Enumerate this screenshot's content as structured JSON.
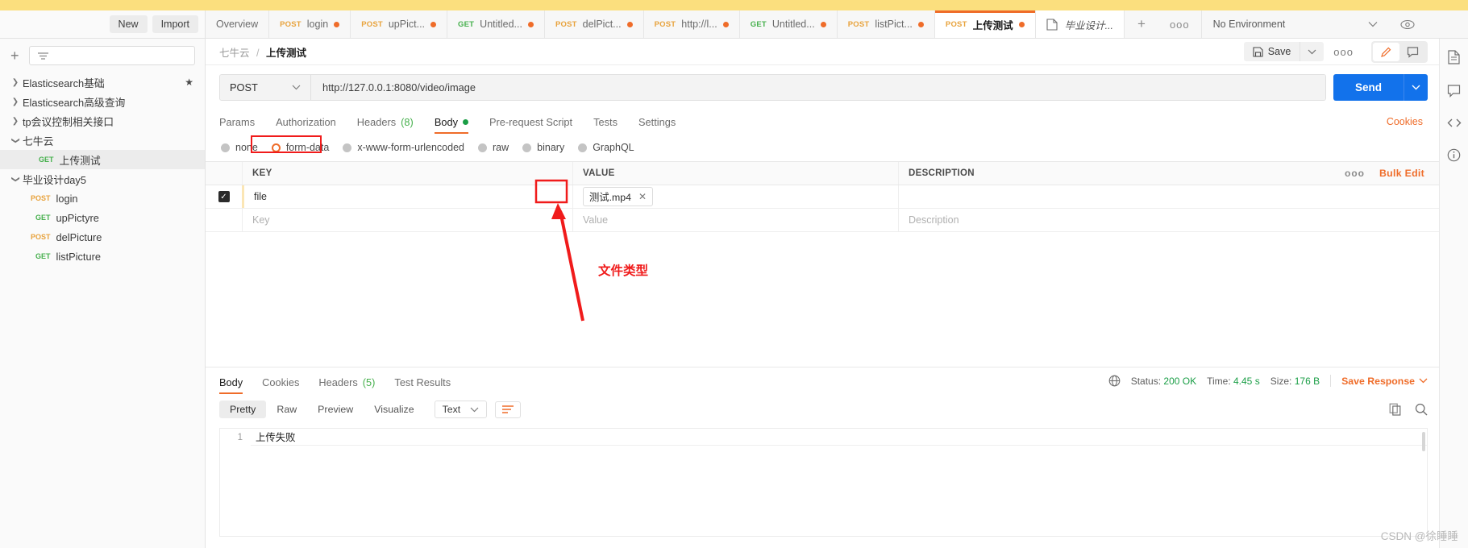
{
  "header": {
    "new_label": "New",
    "import_label": "Import",
    "tabs": [
      {
        "method": "",
        "label": "Overview",
        "dirty": false,
        "active": false,
        "type": "overview"
      },
      {
        "method": "POST",
        "label": "login",
        "dirty": true,
        "active": false,
        "type": "request"
      },
      {
        "method": "POST",
        "label": "upPict...",
        "dirty": true,
        "active": false,
        "type": "request"
      },
      {
        "method": "GET",
        "label": "Untitled...",
        "dirty": true,
        "active": false,
        "type": "request"
      },
      {
        "method": "POST",
        "label": "delPict...",
        "dirty": true,
        "active": false,
        "type": "request"
      },
      {
        "method": "POST",
        "label": "http://l...",
        "dirty": true,
        "active": false,
        "type": "request"
      },
      {
        "method": "GET",
        "label": "Untitled...",
        "dirty": true,
        "active": false,
        "type": "request"
      },
      {
        "method": "POST",
        "label": "listPict...",
        "dirty": true,
        "active": false,
        "type": "request"
      },
      {
        "method": "POST",
        "label": "上传测试",
        "dirty": true,
        "active": true,
        "type": "request"
      },
      {
        "method": "",
        "label": "毕业设计...",
        "dirty": false,
        "active": false,
        "type": "document"
      }
    ],
    "add_tab_icon": "plus-icon",
    "more_tabs_icon": "ellipsis-icon",
    "environment": "No Environment",
    "eye_icon": "eye-icon"
  },
  "sidebar": {
    "add_icon": "plus-icon",
    "filter_icon": "filter-icon",
    "filter_placeholder": "",
    "items": [
      {
        "label": "Elasticsearch基础",
        "expanded": false,
        "starred": true,
        "depth": 0,
        "method": ""
      },
      {
        "label": "Elasticsearch高级查询",
        "expanded": false,
        "starred": false,
        "depth": 0,
        "method": ""
      },
      {
        "label": "tp会议控制相关接口",
        "expanded": false,
        "starred": false,
        "depth": 0,
        "method": ""
      },
      {
        "label": "七牛云",
        "expanded": true,
        "starred": false,
        "depth": 0,
        "method": ""
      },
      {
        "label": "上传测试",
        "expanded": null,
        "starred": false,
        "depth": 1,
        "method": "GET",
        "selected": true
      },
      {
        "label": "毕业设计day5",
        "expanded": true,
        "starred": false,
        "depth": 0,
        "method": ""
      },
      {
        "label": "login",
        "expanded": null,
        "starred": false,
        "depth": 1,
        "method": "POST"
      },
      {
        "label": "upPictyre",
        "expanded": null,
        "starred": false,
        "depth": 1,
        "method": "GET"
      },
      {
        "label": "delPicture",
        "expanded": null,
        "starred": false,
        "depth": 1,
        "method": "POST"
      },
      {
        "label": "listPicture",
        "expanded": null,
        "starred": false,
        "depth": 1,
        "method": "GET"
      }
    ]
  },
  "request": {
    "breadcrumb_collection": "七牛云",
    "breadcrumb_separator": "/",
    "breadcrumb_name": "上传测试",
    "save_label": "Save",
    "save_caret_icon": "chevron-down-icon",
    "more_icon": "ellipsis-icon",
    "edit_icon": "pencil-icon",
    "comment_icon": "comment-icon",
    "method": "POST",
    "method_caret_icon": "chevron-down-icon",
    "url": "http://127.0.0.1:8080/video/image",
    "send_label": "Send",
    "send_caret_icon": "chevron-down-icon",
    "tabs": [
      {
        "label": "Params",
        "active": false,
        "count": null,
        "dot": false
      },
      {
        "label": "Authorization",
        "active": false,
        "count": null,
        "dot": false
      },
      {
        "label": "Headers",
        "active": false,
        "count": "(8)",
        "dot": false
      },
      {
        "label": "Body",
        "active": true,
        "count": null,
        "dot": true
      },
      {
        "label": "Pre-request Script",
        "active": false,
        "count": null,
        "dot": false
      },
      {
        "label": "Tests",
        "active": false,
        "count": null,
        "dot": false
      },
      {
        "label": "Settings",
        "active": false,
        "count": null,
        "dot": false
      }
    ],
    "cookies_link": "Cookies",
    "body_types": [
      {
        "label": "none",
        "selected": false
      },
      {
        "label": "form-data",
        "selected": true,
        "highlighted": true
      },
      {
        "label": "x-www-form-urlencoded",
        "selected": false
      },
      {
        "label": "raw",
        "selected": false
      },
      {
        "label": "binary",
        "selected": false
      },
      {
        "label": "GraphQL",
        "selected": false
      }
    ],
    "table": {
      "columns": [
        "KEY",
        "VALUE",
        "DESCRIPTION"
      ],
      "more_icon": "ellipsis-icon",
      "bulk_edit_label": "Bulk Edit",
      "rows": [
        {
          "checked": true,
          "key": "file",
          "value_chip": "测试.mp4",
          "chip_remove_icon": "close-icon",
          "description": ""
        },
        {
          "checked": false,
          "key": "",
          "value_chip": "",
          "description": "",
          "key_placeholder": "Key",
          "value_placeholder": "Value",
          "description_placeholder": "Description"
        }
      ]
    }
  },
  "annotations": {
    "arrow_note": "文件类型",
    "box_color": "#f01b1b"
  },
  "response": {
    "tabs": [
      {
        "label": "Body",
        "active": true,
        "count": null
      },
      {
        "label": "Cookies",
        "active": false,
        "count": null
      },
      {
        "label": "Headers",
        "active": false,
        "count": "(5)"
      },
      {
        "label": "Test Results",
        "active": false,
        "count": null
      }
    ],
    "globe_icon": "globe-icon",
    "status_label": "Status:",
    "status_value": "200 OK",
    "time_label": "Time:",
    "time_value": "4.45 s",
    "size_label": "Size:",
    "size_value": "176 B",
    "save_response_label": "Save Response",
    "save_response_caret_icon": "chevron-down-icon",
    "view_modes": [
      {
        "label": "Pretty",
        "active": true
      },
      {
        "label": "Raw",
        "active": false
      },
      {
        "label": "Preview",
        "active": false
      },
      {
        "label": "Visualize",
        "active": false
      }
    ],
    "format": "Text",
    "format_caret_icon": "chevron-down-icon",
    "wrap_icon": "wrap-lines-icon",
    "copy_icon": "copy-icon",
    "search_icon": "search-icon",
    "body_lines": [
      {
        "number": "1",
        "text": "上传失败"
      }
    ]
  },
  "rail": {
    "icons": [
      "document-icon",
      "comment-icon",
      "code-icon",
      "info-icon"
    ]
  },
  "watermark": "CSDN @徐睡睡",
  "colors": {
    "accent_orange": "#ef6c29",
    "send_blue": "#1272eb",
    "success_green": "#1a9e46",
    "annotation_red": "#f01b1b",
    "top_strip_yellow": "#fbdf7e"
  }
}
